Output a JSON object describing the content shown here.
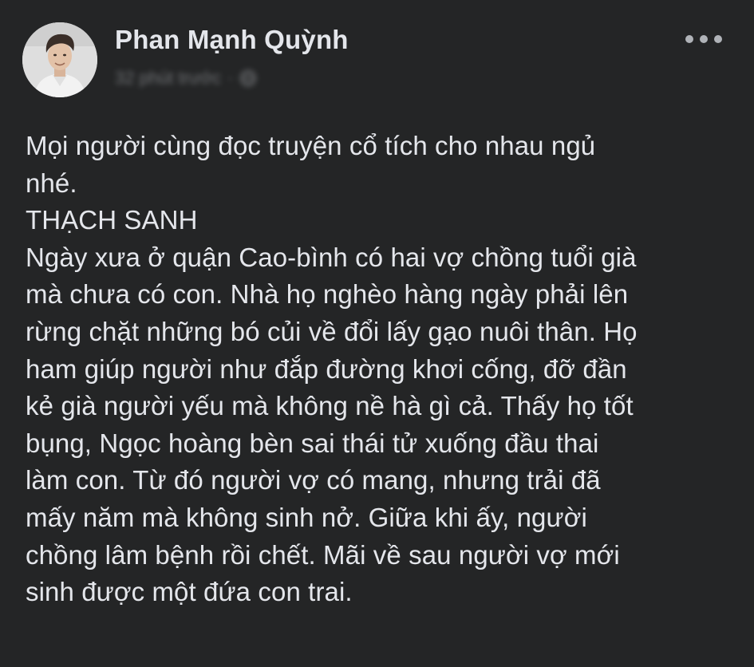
{
  "post": {
    "author": "Phan Mạnh Quỳnh",
    "timestamp": "32 phút trước",
    "separator": "·",
    "privacy_icon": "globe-icon",
    "more_icon": "more-dots-icon",
    "lines": [
      "Mọi người cùng đọc truyện cổ tích cho nhau ngủ",
      "nhé.",
      "THẠCH SANH",
      "Ngày xưa ở quận Cao-bình có hai vợ chồng tuổi già",
      "mà chưa có con. Nhà họ nghèo hàng ngày phải lên",
      "rừng chặt những bó củi về đổi lấy gạo nuôi thân. Họ",
      "ham giúp người như đắp đường khơi cống, đỡ đần",
      "kẻ già người yếu mà không nề hà gì cả. Thấy họ tốt",
      "bụng, Ngọc hoàng bèn sai thái tử xuống đầu thai",
      "làm con. Từ đó người vợ có mang, nhưng trải đã",
      "mấy năm mà không sinh nở. Giữa khi ấy, người",
      "chồng lâm bệnh rồi chết. Mãi về sau người vợ mới",
      "sinh được một đứa con trai."
    ]
  },
  "colors": {
    "background": "#242526",
    "primary_text": "#e4e6eb",
    "secondary_text": "#b0b3b8"
  }
}
